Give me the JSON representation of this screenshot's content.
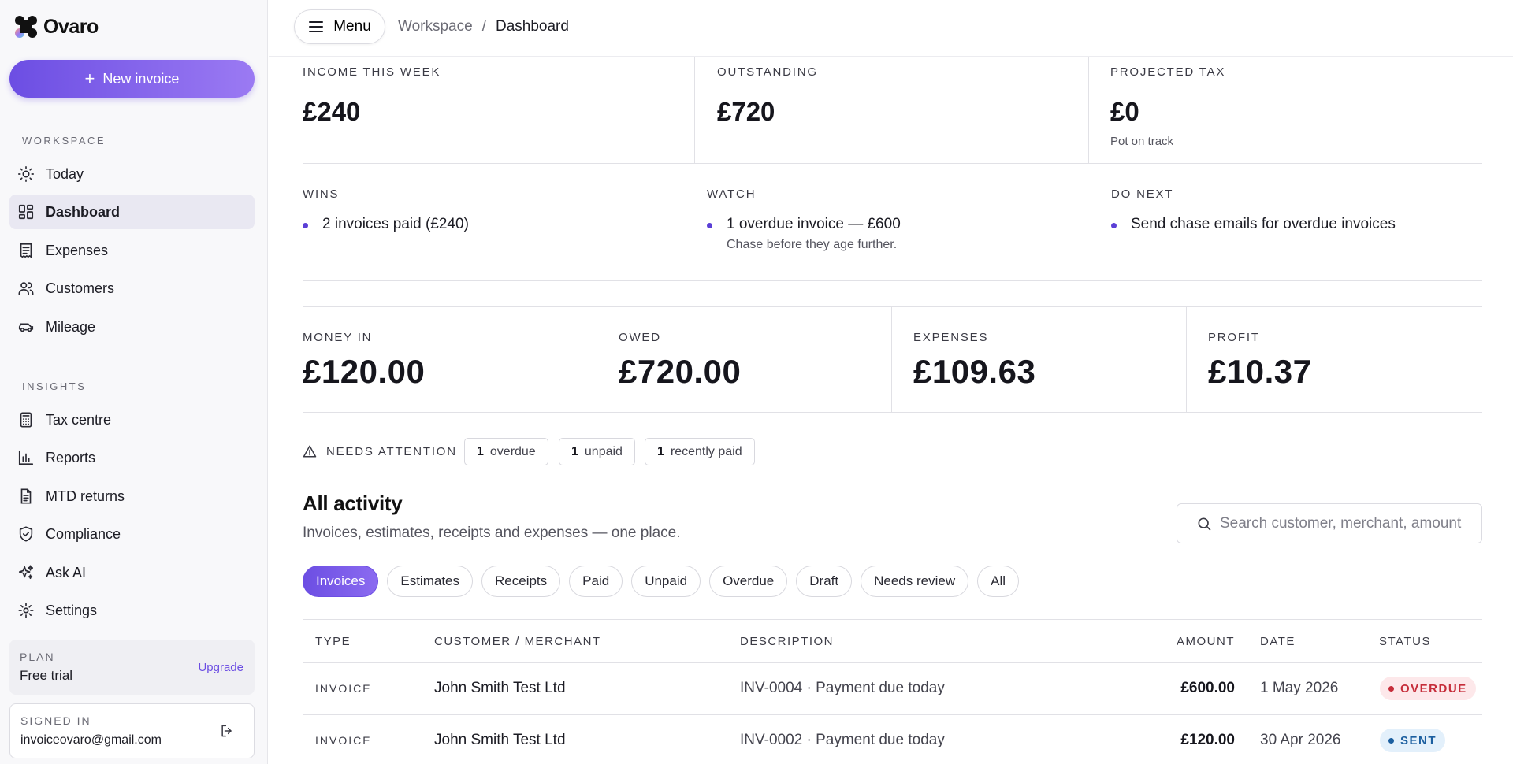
{
  "app": {
    "name": "Ovaro"
  },
  "sidebar": {
    "new_invoice_label": "New invoice",
    "workspace_label": "WORKSPACE",
    "workspace_items": [
      {
        "label": "Today",
        "icon": "sun-icon"
      },
      {
        "label": "Dashboard",
        "icon": "grid-icon",
        "active": true
      },
      {
        "label": "Expenses",
        "icon": "receipt-icon"
      },
      {
        "label": "Customers",
        "icon": "users-icon"
      },
      {
        "label": "Mileage",
        "icon": "car-icon"
      }
    ],
    "insights_label": "INSIGHTS",
    "insights_items": [
      {
        "label": "Tax centre",
        "icon": "calculator-icon"
      },
      {
        "label": "Reports",
        "icon": "bar-chart-icon"
      },
      {
        "label": "MTD returns",
        "icon": "document-icon"
      },
      {
        "label": "Compliance",
        "icon": "shield-check-icon"
      },
      {
        "label": "Ask AI",
        "icon": "sparkle-icon"
      },
      {
        "label": "Settings",
        "icon": "gear-icon"
      }
    ],
    "plan": {
      "label": "PLAN",
      "value": "Free trial",
      "upgrade_label": "Upgrade"
    },
    "signed_in": {
      "label": "SIGNED IN",
      "email": "invoiceovaro@gmail.com"
    }
  },
  "topbar": {
    "menu_label": "Menu",
    "breadcrumb": {
      "parent": "Workspace",
      "separator": "/",
      "current": "Dashboard"
    }
  },
  "summary": {
    "income_week": {
      "label": "INCOME THIS WEEK",
      "value": "£240"
    },
    "outstanding": {
      "label": "OUTSTANDING",
      "value": "£720"
    },
    "projected_tax": {
      "label": "PROJECTED TAX",
      "value": "£0",
      "sub": "Pot on track"
    }
  },
  "insights": {
    "wins": {
      "label": "WINS",
      "text": "2 invoices paid (£240)"
    },
    "watch": {
      "label": "WATCH",
      "text": "1 overdue invoice — £600",
      "sub": "Chase before they age further."
    },
    "do_next": {
      "label": "DO NEXT",
      "text": "Send chase emails for overdue invoices"
    }
  },
  "totals": {
    "money_in": {
      "label": "MONEY IN",
      "value": "£120.00"
    },
    "owed": {
      "label": "OWED",
      "value": "£720.00"
    },
    "expenses": {
      "label": "EXPENSES",
      "value": "£109.63"
    },
    "profit": {
      "label": "PROFIT",
      "value": "£10.37"
    }
  },
  "attention": {
    "label": "NEEDS ATTENTION",
    "chips": [
      {
        "count": "1",
        "label": "overdue"
      },
      {
        "count": "1",
        "label": "unpaid"
      },
      {
        "count": "1",
        "label": "recently paid"
      }
    ]
  },
  "activity": {
    "title": "All activity",
    "subtitle": "Invoices, estimates, receipts and expenses — one place.",
    "search_placeholder": "Search customer, merchant, amount",
    "tabs": [
      "Invoices",
      "Estimates",
      "Receipts",
      "Paid",
      "Unpaid",
      "Overdue",
      "Draft",
      "Needs review",
      "All"
    ],
    "active_tab": "Invoices",
    "columns": {
      "type": "TYPE",
      "customer": "CUSTOMER / MERCHANT",
      "description": "DESCRIPTION",
      "amount": "AMOUNT",
      "date": "DATE",
      "status": "STATUS"
    },
    "rows": [
      {
        "type": "INVOICE",
        "customer": "John Smith Test Ltd",
        "description": "INV-0004 · Payment due today",
        "amount": "£600.00",
        "date": "1 May 2026",
        "status": "OVERDUE",
        "status_kind": "overdue"
      },
      {
        "type": "INVOICE",
        "customer": "John Smith Test Ltd",
        "description": "INV-0002 · Payment due today",
        "amount": "£120.00",
        "date": "30 Apr 2026",
        "status": "SENT",
        "status_kind": "sent"
      }
    ]
  },
  "colors": {
    "accent": "#6c4ee3",
    "overdue": "#c62d3a",
    "sent": "#1c5fa0"
  }
}
